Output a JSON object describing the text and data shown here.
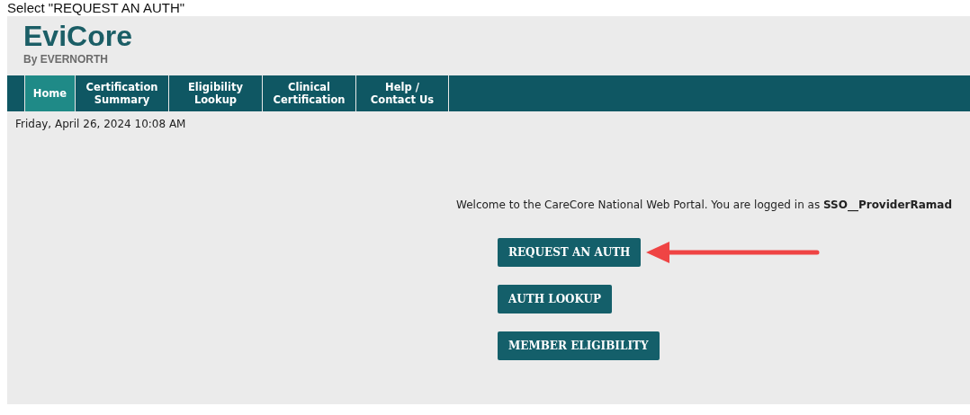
{
  "caption": "Select \"REQUEST AN AUTH\"",
  "logo": {
    "name": "EviCore",
    "tagline": "By EVERNORTH"
  },
  "nav": [
    {
      "label": "Home",
      "selected": true
    },
    {
      "label": "Certification Summary",
      "selected": false
    },
    {
      "label": "Eligibility Lookup",
      "selected": false
    },
    {
      "label": "Clinical Certification",
      "selected": false
    },
    {
      "label": "Help / Contact Us",
      "selected": false
    }
  ],
  "date": "Friday, April 26, 2024 10:08 AM",
  "welcome": "Welcome to the CareCore National Web Portal. You are logged in as **SSO__ProviderRamad**",
  "actions": [
    {
      "label": "REQUEST AN AUTH",
      "highlighted": true
    },
    {
      "label": "AUTH LOOKUP",
      "highlighted": false
    },
    {
      "label": "MEMBER ELIGIBILITY",
      "highlighted": false
    }
  ]
}
